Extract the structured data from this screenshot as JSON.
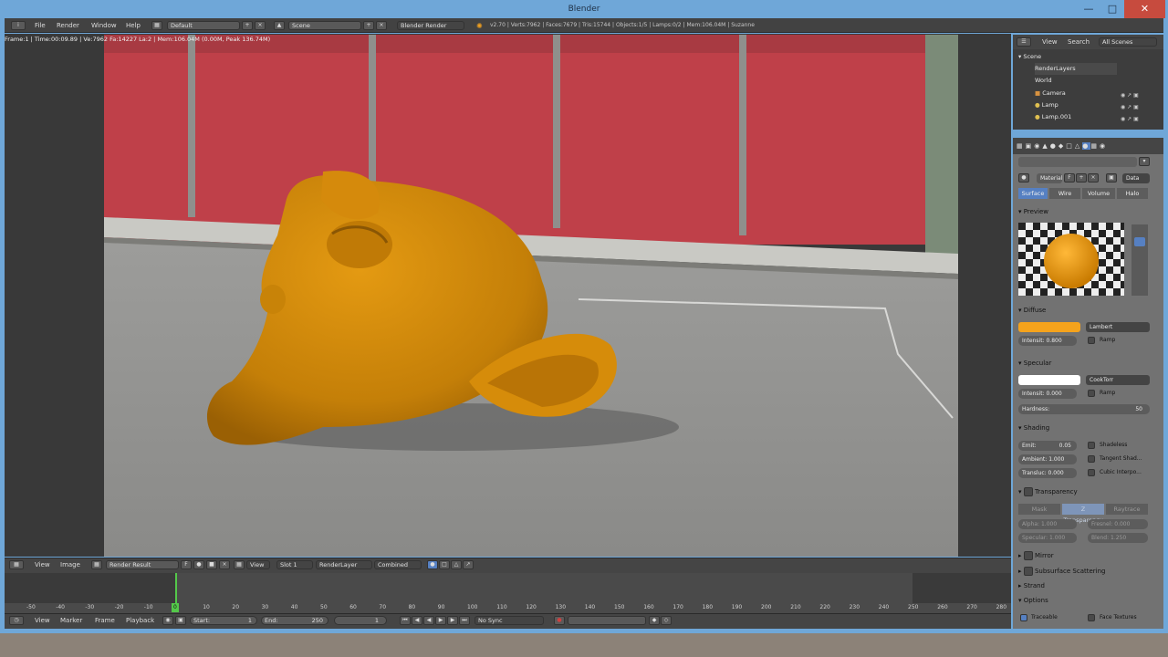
{
  "window": {
    "title": "Blender"
  },
  "menu": {
    "file": "File",
    "render": "Render",
    "window": "Window",
    "help": "Help"
  },
  "header": {
    "layout": "Default",
    "scene": "Scene",
    "engine": "Blender Render",
    "stats": "v2.70 | Verts:7962 | Faces:7679 | Tris:15744 | Objects:1/5 | Lamps:0/2 | Mem:106.04M | Suzanne"
  },
  "render_stamp": "Frame:1 | Time:00:09.89 | Ve:7962 Fa:14227 La:2 | Mem:106.04M (0.00M, Peak 136.74M)",
  "image_editor_header": {
    "view": "View",
    "image": "Image",
    "image_name": "Render Result",
    "f_label": "F",
    "view2": "View",
    "slot": "Slot 1",
    "layer": "RenderLayer",
    "pass": "Combined"
  },
  "timeline": {
    "ticks": [
      "-50",
      "-40",
      "-30",
      "-20",
      "-10",
      "0",
      "10",
      "20",
      "30",
      "40",
      "50",
      "60",
      "70",
      "80",
      "90",
      "100",
      "110",
      "120",
      "130",
      "140",
      "150",
      "160",
      "170",
      "180",
      "190",
      "200",
      "210",
      "220",
      "230",
      "240",
      "250",
      "260",
      "270",
      "280"
    ],
    "current_frame": "0"
  },
  "timeline_header": {
    "view": "View",
    "marker": "Marker",
    "frame": "Frame",
    "playback": "Playback",
    "start": "Start:",
    "start_val": "1",
    "end": "End:",
    "end_val": "250",
    "current": "1",
    "sync": "No Sync"
  },
  "outliner": {
    "view": "View",
    "search": "Search",
    "filter": "All Scenes",
    "rows": [
      "Scene",
      "RenderLayers",
      "World",
      "Camera",
      "Lamp",
      "Lamp.001"
    ]
  },
  "properties": {
    "material_name": "Material",
    "data_label": "Data",
    "tabs": [
      "Surface",
      "Wire",
      "Volume",
      "Halo"
    ],
    "preview": "Preview",
    "diffuse": {
      "title": "Diffuse",
      "shader": "Lambert",
      "intensity": "Intensit: 0.800",
      "ramp": "Ramp",
      "color": "#f5a31c"
    },
    "specular": {
      "title": "Specular",
      "shader": "CookTorr",
      "intensity": "Intensit: 0.000",
      "ramp": "Ramp",
      "hardness": "Hardness:",
      "hardness_val": "50",
      "color": "#ffffff"
    },
    "shading": {
      "title": "Shading",
      "emit": "Emit:",
      "emit_val": "0.05",
      "ambient": "Ambient: 1.000",
      "translucency": "Transluc: 0.000",
      "shadeless": "Shadeless",
      "tangent": "Tangent Shad...",
      "cubic": "Cubic Interpo..."
    },
    "transparency": {
      "title": "Transparency",
      "modes": [
        "Mask",
        "Z Transparency",
        "Raytrace"
      ],
      "alpha": "Alpha: 1.000",
      "fresnel": "Fresnel: 0.000",
      "specular": "Specular: 1.000",
      "blend": "Blend: 1.250"
    },
    "sections": [
      "Mirror",
      "Subsurface Scattering",
      "Strand",
      "Options"
    ],
    "options": {
      "traceable": "Traceable",
      "face_textures": "Face Textures"
    }
  }
}
